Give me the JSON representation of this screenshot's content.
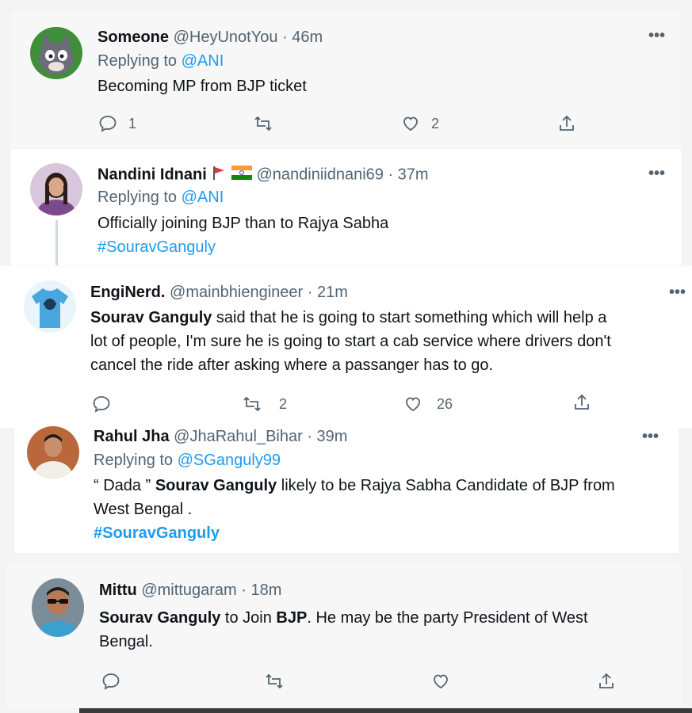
{
  "tweets": [
    {
      "name": "Someone",
      "handle": "@HeyUnotYou",
      "time": "· 46m",
      "replying_label": "Replying to",
      "replying_to": "@ANI",
      "text": "Becoming MP from BJP ticket",
      "reply_count": "1",
      "retweet_count": "",
      "like_count": "2",
      "avatar": "cartoon-cat-avatar"
    },
    {
      "name": "Nandini Idnani",
      "handle": "@nandiniidnani69",
      "time": "· 37m",
      "replying_label": "Replying to",
      "replying_to": "@ANI",
      "text": "Officially joining BJP than to Rajya Sabha",
      "hashtag": "#SouravGanguly",
      "avatar": "woman-photo-avatar",
      "flags": [
        "red-flag-icon",
        "india-flag-icon"
      ]
    },
    {
      "name": "EngiNerd.",
      "handle": "@mainbhiengineer",
      "time": "· 21m",
      "bold_lead": "Sourav Ganguly",
      "text_line1": " said that he is going to start something which will help a",
      "text_line2": "lot of people, I'm sure he is going to start a cab service where drivers don't",
      "text_line3": "cancel the ride after asking where a passanger has to go.",
      "reply_count": "",
      "retweet_count": "2",
      "like_count": "26",
      "avatar": "blue-tshirt-avatar"
    },
    {
      "name": "Rahul Jha",
      "handle": "@JhaRahul_Bihar",
      "time": "· 39m",
      "replying_label": "Replying to",
      "replying_to": "@SGanguly99",
      "text_pre": "“ Dada ” ",
      "bold_lead": "Sourav Ganguly",
      "text_line1": " likely to be Rajya Sabha Candidate of BJP from",
      "text_line2": "West Bengal .",
      "hashtag": "#SouravGanguly",
      "avatar": "man-photo-avatar"
    },
    {
      "name": "Mittu",
      "handle": "@mittugaram",
      "time": "· 18m",
      "bold_lead": "Sourav Ganguly",
      "text_mid": " to Join ",
      "bold_mid": "BJP",
      "text_line1": ". He may be the party President of West",
      "text_line2": "Bengal.",
      "avatar": "man-sunglasses-avatar"
    }
  ],
  "more_glyph": "•••",
  "colors": {
    "link": "#1d9bf0",
    "meta": "#536471",
    "text": "#0f1419",
    "backdrop": "#f7f7f7"
  }
}
